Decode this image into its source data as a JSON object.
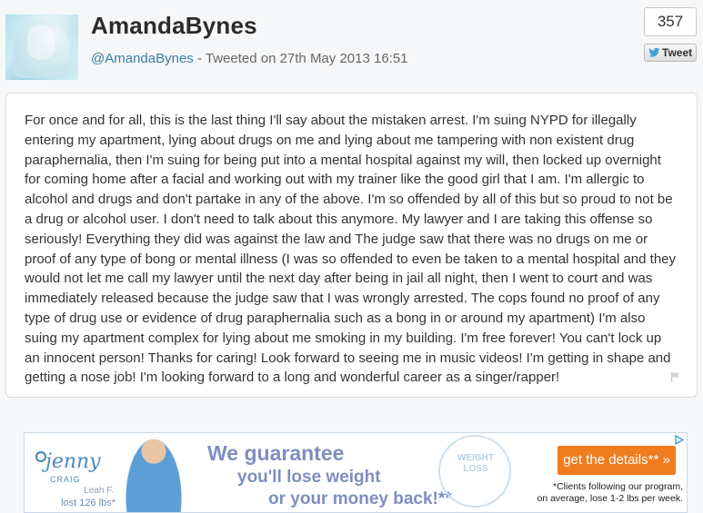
{
  "tweet": {
    "author_name": "AmandaBynes",
    "handle": "@AmandaBynes",
    "meta_text": " - Tweeted on 27th May 2013 16:51",
    "retweet_count": "357",
    "tweet_button_label": "Tweet",
    "body": "For once and for all, this is the last thing I'll say about the mistaken arrest. I'm suing NYPD for illegally entering my apartment, lying about drugs on me and lying about me tampering with non existent drug paraphernalia, then I'm suing for being put into a mental hospital against my will, then locked up overnight for coming home after a facial and working out with my trainer like the good girl that I am. I'm allergic to alcohol and drugs and don't partake in any of the above. I'm so offended by all of this but so proud to not be a drug or alcohol user. I don't need to talk about this anymore. My lawyer and I are taking this offense so seriously! Everything they did was against the law and The judge saw that there was no drugs on me or proof of any type of bong or mental illness (I was so offended to even be taken to a mental hospital and they would not let me call my lawyer until the next day after being in jail all night, then I went to court and was immediately released because the judge saw that I was wrongly arrested. The cops found no proof of any type of drug use or evidence of drug paraphernalia such as a bong in or around my apartment) I'm also suing my apartment complex for lying about me smoking in my building. I'm free forever! You can't lock up an innocent person! Thanks for caring! Look forward to seeing me in music videos! I'm getting in shape and getting a nose job! I'm looking forward to a long and wonderful career as a singer/rapper!"
  },
  "ad": {
    "brand_top": "jenny",
    "brand_bottom": "CRAIG",
    "person_name": "Leah F.",
    "person_result": "lost 126 lbs*",
    "headline_1": "We guarantee",
    "headline_2": "you'll lose weight",
    "headline_3": "or your money back!**",
    "badge_text": "WEIGHT LOSS",
    "cta_label": "get the details** »",
    "fine_print_1": "*Clients following our program,",
    "fine_print_2": "on average, lose 1-2 lbs per week."
  },
  "icons": [
    "avatar-image",
    "twitter-bird-icon",
    "flag-icon",
    "adchoices-icon"
  ],
  "colors": {
    "accent_link": "#3b7ea1",
    "cta": "#f07c1e",
    "ad_headline": "#7d8fc0"
  }
}
